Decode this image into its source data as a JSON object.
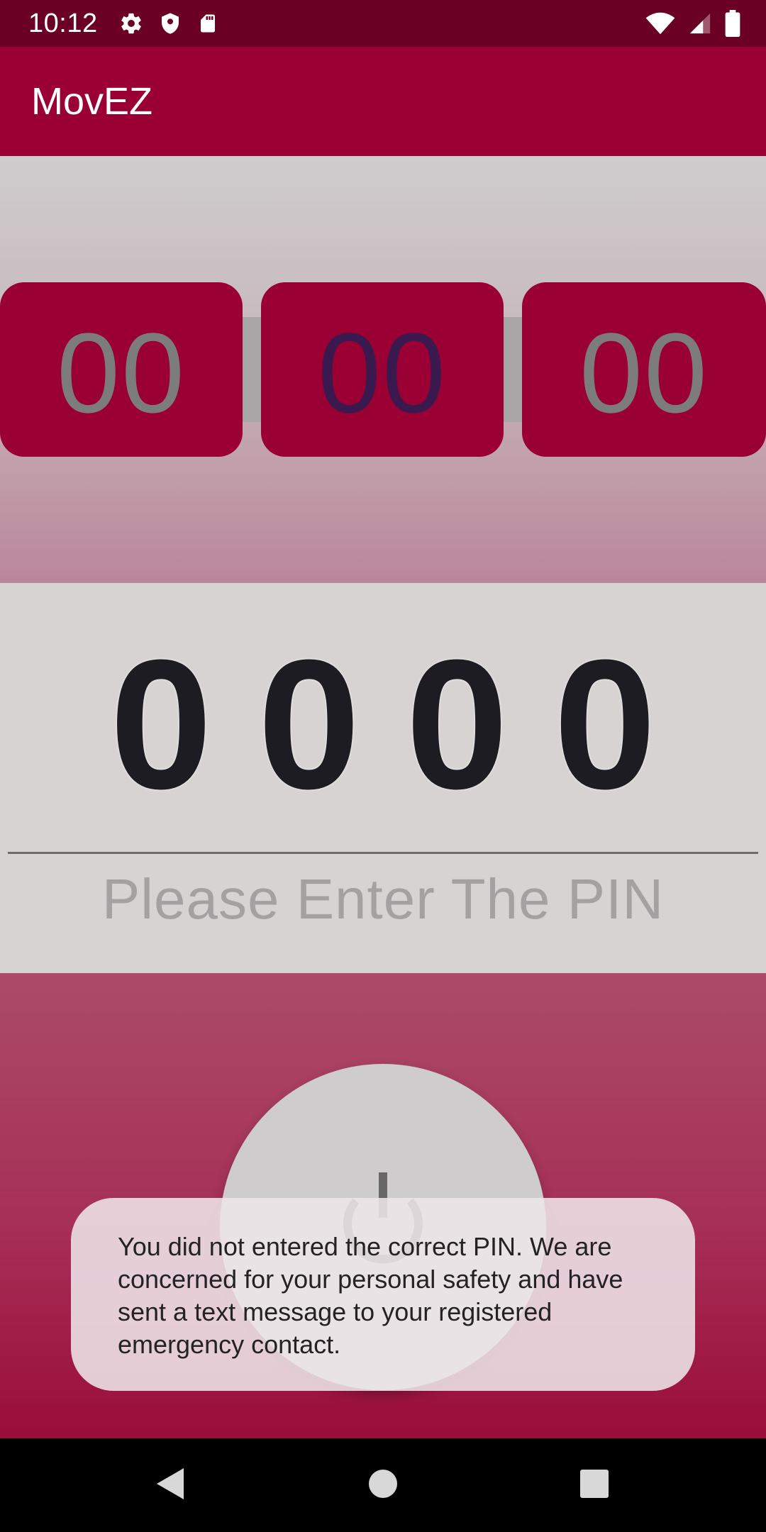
{
  "status_bar": {
    "time": "10:12",
    "left_icons": [
      "settings-icon",
      "shield-icon",
      "sd-card-icon"
    ],
    "right_icons": [
      "wifi-icon",
      "cell-signal-icon",
      "battery-icon"
    ]
  },
  "app_bar": {
    "title": "MovEZ",
    "color": "#9a0034"
  },
  "timer": {
    "hours": "00",
    "minutes": "00",
    "seconds": "00"
  },
  "pin": {
    "digits": [
      "0",
      "0",
      "0",
      "0"
    ],
    "hint": "Please Enter The PIN"
  },
  "power_button": {
    "icon": "power-icon"
  },
  "toast": {
    "message": "You did not entered the correct PIN. We are concerned for your personal safety and have sent a text message to your registered emergency contact."
  },
  "nav_bar": {
    "buttons": [
      "back-icon",
      "home-icon",
      "recents-icon"
    ]
  }
}
